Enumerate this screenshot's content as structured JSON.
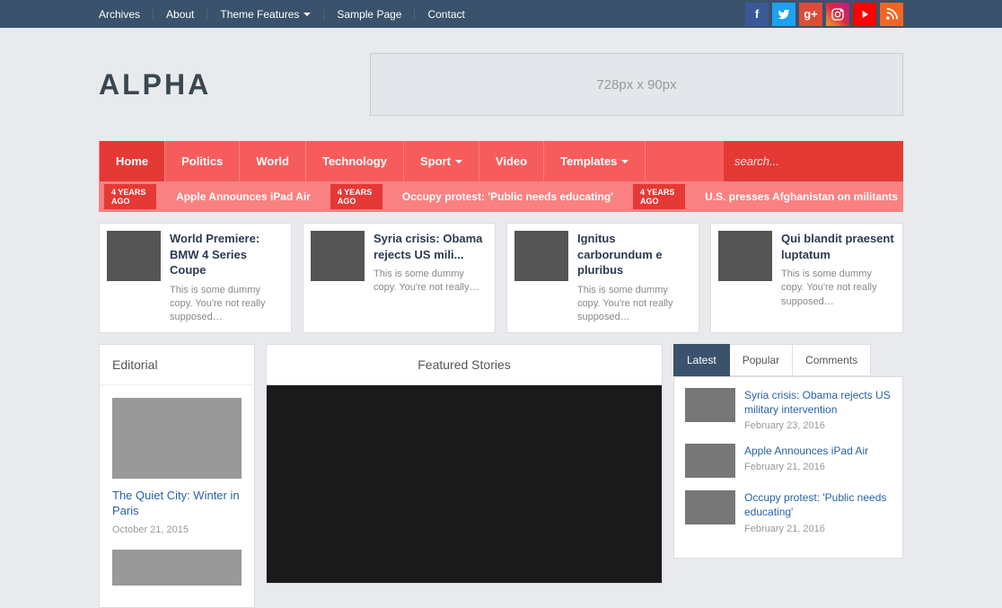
{
  "topnav": [
    "Archives",
    "About",
    "Theme Features",
    "Sample Page",
    "Contact"
  ],
  "topnav_dropdown": [
    false,
    false,
    true,
    false,
    false
  ],
  "social": [
    {
      "name": "facebook",
      "class": "fb",
      "glyph": "f"
    },
    {
      "name": "twitter",
      "class": "tw",
      "glyph": "t"
    },
    {
      "name": "google-plus",
      "class": "gp",
      "glyph": "g+"
    },
    {
      "name": "instagram",
      "class": "ig",
      "glyph": "◎"
    },
    {
      "name": "youtube",
      "class": "yt",
      "glyph": "▶"
    },
    {
      "name": "rss",
      "class": "rss",
      "glyph": "න"
    }
  ],
  "logo": "ALPHA",
  "ad_text": "728px x 90px",
  "mainnav": [
    {
      "label": "Home",
      "active": true
    },
    {
      "label": "Politics"
    },
    {
      "label": "World"
    },
    {
      "label": "Technology"
    },
    {
      "label": "Sport",
      "dropdown": true
    },
    {
      "label": "Video"
    },
    {
      "label": "Templates",
      "dropdown": true
    }
  ],
  "search_placeholder": "search...",
  "ticker": [
    {
      "badge": "4 YEARS AGO",
      "text": "Apple Announces iPad Air"
    },
    {
      "badge": "4 YEARS AGO",
      "text": "Occupy protest: 'Public needs educating'"
    },
    {
      "badge": "4 YEARS AGO",
      "text": "U.S. presses Afghanistan on militants"
    }
  ],
  "cards": [
    {
      "title": "World Premiere: BMW 4 Series Coupe",
      "desc": "This is some dummy copy. You're not really supposed…"
    },
    {
      "title": "Syria crisis: Obama rejects US mili...",
      "desc": "This is some dummy copy. You're not really…"
    },
    {
      "title": "Ignitus carborundum e pluribus",
      "desc": "This is some dummy copy. You're not really supposed…"
    },
    {
      "title": "Qui blandit praesent luptatum",
      "desc": "This is some dummy copy. You're not really supposed…"
    }
  ],
  "editorial_head": "Editorial",
  "editorial": [
    {
      "title": "The Quiet City: Winter in Paris",
      "date": "October 21, 2015"
    }
  ],
  "featured_head": "Featured Stories",
  "tabs": [
    "Latest",
    "Popular",
    "Comments"
  ],
  "active_tab": 0,
  "latest": [
    {
      "title": "Syria crisis: Obama rejects US military intervention",
      "date": "February 23, 2016"
    },
    {
      "title": "Apple Announces iPad Air",
      "date": "February 21, 2016"
    },
    {
      "title": "Occupy protest: 'Public needs educating'",
      "date": "February 21, 2016"
    }
  ]
}
